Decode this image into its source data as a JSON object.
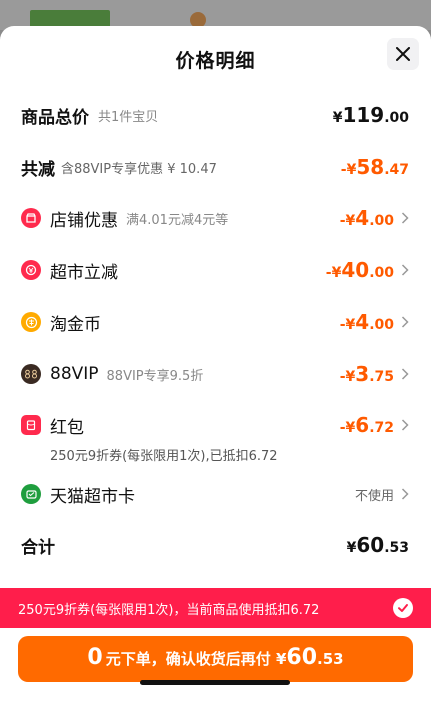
{
  "page_title": "价格明细",
  "total": {
    "label": "商品总价",
    "sub": "共1件宝贝",
    "currency": "¥",
    "int": "119",
    "dec": ".00"
  },
  "discount": {
    "label": "共减",
    "sub": "含88VIP专享优惠 ¥ 10.47",
    "prefix": "-¥",
    "int": "58",
    "dec": ".47"
  },
  "items": [
    {
      "icon": "shop-icon",
      "label": "店铺优惠",
      "sub": "满4.01元减4元等",
      "prefix": "-¥",
      "int": "4",
      "dec": ".00"
    },
    {
      "icon": "supermarket-discount-icon",
      "label": "超市立减",
      "sub": "",
      "prefix": "-¥",
      "int": "40",
      "dec": ".00"
    },
    {
      "icon": "taojinbi-coin-icon",
      "label": "淘金币",
      "sub": "",
      "prefix": "-¥",
      "int": "4",
      "dec": ".00"
    },
    {
      "icon": "88vip-icon",
      "label": "88VIP",
      "sub": "88VIP专享9.5折",
      "prefix": "-¥",
      "int": "3",
      "dec": ".75"
    },
    {
      "icon": "red-packet-icon",
      "label": "红包",
      "sub": "",
      "prefix": "-¥",
      "int": "6",
      "dec": ".72",
      "note": "250元9折券(每张限用1次),已抵扣6.72"
    },
    {
      "icon": "tmall-supermarket-card-icon",
      "label": "天猫超市卡",
      "value": "不使用"
    }
  ],
  "sum": {
    "label": "合计",
    "currency": "¥",
    "int": "60",
    "dec": ".53"
  },
  "banner": {
    "text": "250元9折券(每张限用1次)，当前商品使用抵扣6.72"
  },
  "pay_button": {
    "p0": "0",
    "p1": "元下单，确认收货后再付 ¥",
    "p2": "60",
    "p3": ".53"
  },
  "colors": {
    "accent": "#ff5a00",
    "banner": "#ff1e4b",
    "button": "#ff6a00"
  }
}
